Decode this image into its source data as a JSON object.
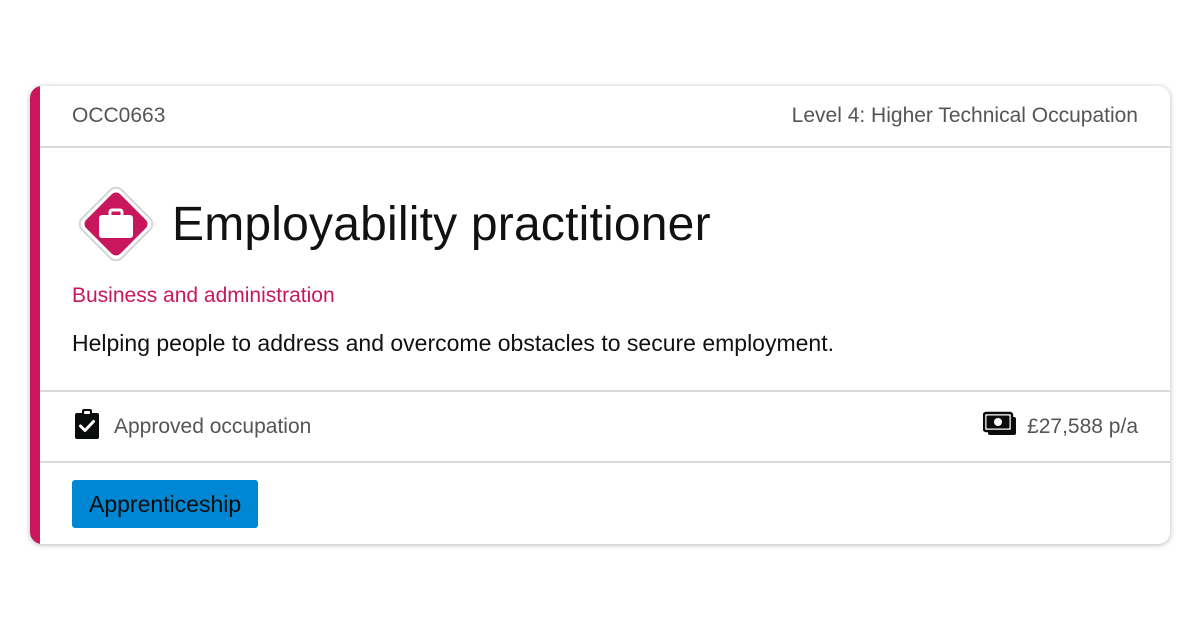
{
  "card": {
    "reference": "OCC0663",
    "level": "Level 4: Higher Technical Occupation",
    "title": "Employability practitioner",
    "route": "Business and administration",
    "summary": "Helping people to address and overcome obstacles to secure employment.",
    "status": "Approved occupation",
    "salary": "£27,588 p/a",
    "tag_label": "Apprenticeship"
  },
  "icons": {
    "route_icon": "briefcase-icon",
    "status_icon": "clipboard-check-icon",
    "salary_icon": "money-icon"
  },
  "colors": {
    "accent": "#c8175d",
    "tag_background": "#0087d4",
    "muted_text": "#555555"
  }
}
